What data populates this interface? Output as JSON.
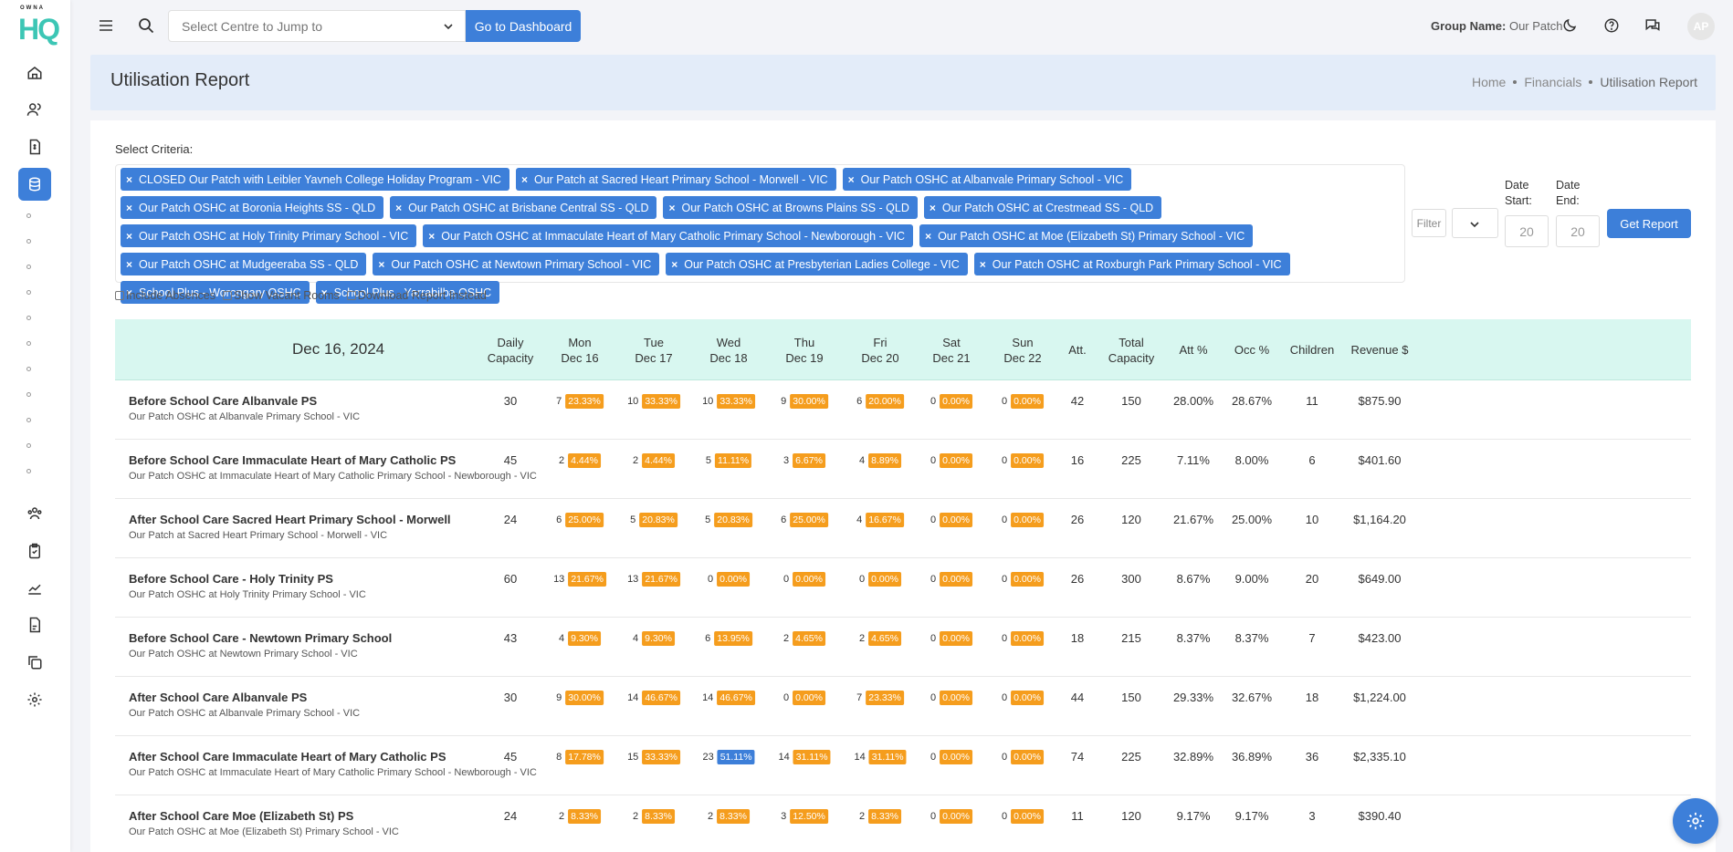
{
  "logo": {
    "top": "OWNA",
    "main": "HQ"
  },
  "topbar": {
    "centre_placeholder": "Select Centre to Jump to",
    "dashboard_button": "Go to Dashboard",
    "group_label": "Group Name:",
    "group_value": "Our Patch",
    "avatar_initials": "AP"
  },
  "header": {
    "title": "Utilisation Report",
    "breadcrumb": [
      "Home",
      "Financials",
      "Utilisation Report"
    ]
  },
  "criteria": {
    "label": "Select Criteria:",
    "chips": [
      "CLOSED Our Patch with Leibler Yavneh College Holiday Program - VIC",
      "Our Patch at Sacred Heart Primary School - Morwell - VIC",
      "Our Patch OSHC at Albanvale Primary School - VIC",
      "Our Patch OSHC at Boronia Heights SS - QLD",
      "Our Patch OSHC at Brisbane Central SS - QLD",
      "Our Patch OSHC at Browns Plains SS - QLD",
      "Our Patch OSHC at Crestmead SS - QLD",
      "Our Patch OSHC at Holy Trinity Primary School - VIC",
      "Our Patch OSHC at Immaculate Heart of Mary Catholic Primary School - Newborough - VIC",
      "Our Patch OSHC at Moe (Elizabeth St) Primary School - VIC",
      "Our Patch OSHC at Mudgeeraba SS - QLD",
      "Our Patch OSHC at Newtown Primary School - VIC",
      "Our Patch OSHC at Presbyterian Ladies College - VIC",
      "Our Patch OSHC at Roxburgh Park Primary School - VIC",
      "School Plus - Worongary OSHC",
      "School Plus - Yarrabilba OSHC"
    ],
    "filter_label": "Filter",
    "date_start_label": "Date Start:",
    "date_end_label": "Date End:",
    "date_start_value": "20",
    "date_end_value": "20",
    "get_report": "Get Report",
    "include_absences": "Include Absences",
    "show_vacant": "Show Vacant Rooms",
    "download_instead": "Download Report Instead"
  },
  "table": {
    "date_title": "Dec 16, 2024",
    "columns": {
      "daily_capacity": "Daily Capacity",
      "days": [
        [
          "Mon",
          "Dec 16"
        ],
        [
          "Tue",
          "Dec 17"
        ],
        [
          "Wed",
          "Dec 18"
        ],
        [
          "Thu",
          "Dec 19"
        ],
        [
          "Fri",
          "Dec 20"
        ],
        [
          "Sat",
          "Dec 21"
        ],
        [
          "Sun",
          "Dec 22"
        ]
      ],
      "att": "Att.",
      "total_capacity": "Total Capacity",
      "att_pct": "Att %",
      "occ_pct": "Occ %",
      "children": "Children",
      "revenue": "Revenue $"
    },
    "rows": [
      {
        "name": "Before School Care Albanvale PS",
        "centre": "Our Patch OSHC at Albanvale Primary School - VIC",
        "cap": "30",
        "days": [
          [
            "7",
            "23.33%"
          ],
          [
            "10",
            "33.33%"
          ],
          [
            "10",
            "33.33%"
          ],
          [
            "9",
            "30.00%"
          ],
          [
            "6",
            "20.00%"
          ],
          [
            "0",
            "0.00%"
          ],
          [
            "0",
            "0.00%"
          ]
        ],
        "att": "42",
        "total": "150",
        "attp": "28.00%",
        "occp": "28.67%",
        "children": "11",
        "revenue": "$875.90"
      },
      {
        "name": "Before School Care Immaculate Heart of Mary Catholic PS",
        "centre": "Our Patch OSHC at Immaculate Heart of Mary Catholic Primary School - Newborough - VIC",
        "cap": "45",
        "days": [
          [
            "2",
            "4.44%"
          ],
          [
            "2",
            "4.44%"
          ],
          [
            "5",
            "11.11%"
          ],
          [
            "3",
            "6.67%"
          ],
          [
            "4",
            "8.89%"
          ],
          [
            "0",
            "0.00%"
          ],
          [
            "0",
            "0.00%"
          ]
        ],
        "att": "16",
        "total": "225",
        "attp": "7.11%",
        "occp": "8.00%",
        "children": "6",
        "revenue": "$401.60"
      },
      {
        "name": "After School Care Sacred Heart Primary School - Morwell",
        "centre": "Our Patch at Sacred Heart Primary School - Morwell - VIC",
        "cap": "24",
        "days": [
          [
            "6",
            "25.00%"
          ],
          [
            "5",
            "20.83%"
          ],
          [
            "5",
            "20.83%"
          ],
          [
            "6",
            "25.00%"
          ],
          [
            "4",
            "16.67%"
          ],
          [
            "0",
            "0.00%"
          ],
          [
            "0",
            "0.00%"
          ]
        ],
        "att": "26",
        "total": "120",
        "attp": "21.67%",
        "occp": "25.00%",
        "children": "10",
        "revenue": "$1,164.20"
      },
      {
        "name": "Before School Care - Holy Trinity PS",
        "centre": "Our Patch OSHC at Holy Trinity Primary School - VIC",
        "cap": "60",
        "days": [
          [
            "13",
            "21.67%"
          ],
          [
            "13",
            "21.67%"
          ],
          [
            "0",
            "0.00%"
          ],
          [
            "0",
            "0.00%"
          ],
          [
            "0",
            "0.00%"
          ],
          [
            "0",
            "0.00%"
          ],
          [
            "0",
            "0.00%"
          ]
        ],
        "att": "26",
        "total": "300",
        "attp": "8.67%",
        "occp": "9.00%",
        "children": "20",
        "revenue": "$649.00"
      },
      {
        "name": "Before School Care - Newtown Primary School",
        "centre": "Our Patch OSHC at Newtown Primary School - VIC",
        "cap": "43",
        "days": [
          [
            "4",
            "9.30%"
          ],
          [
            "4",
            "9.30%"
          ],
          [
            "6",
            "13.95%"
          ],
          [
            "2",
            "4.65%"
          ],
          [
            "2",
            "4.65%"
          ],
          [
            "0",
            "0.00%"
          ],
          [
            "0",
            "0.00%"
          ]
        ],
        "att": "18",
        "total": "215",
        "attp": "8.37%",
        "occp": "8.37%",
        "children": "7",
        "revenue": "$423.00"
      },
      {
        "name": "After School Care Albanvale PS",
        "centre": "Our Patch OSHC at Albanvale Primary School - VIC",
        "cap": "30",
        "days": [
          [
            "9",
            "30.00%"
          ],
          [
            "14",
            "46.67%"
          ],
          [
            "14",
            "46.67%"
          ],
          [
            "0",
            "0.00%"
          ],
          [
            "7",
            "23.33%"
          ],
          [
            "0",
            "0.00%"
          ],
          [
            "0",
            "0.00%"
          ]
        ],
        "att": "44",
        "total": "150",
        "attp": "29.33%",
        "occp": "32.67%",
        "children": "18",
        "revenue": "$1,224.00"
      },
      {
        "name": "After School Care Immaculate Heart of Mary Catholic PS",
        "centre": "Our Patch OSHC at Immaculate Heart of Mary Catholic Primary School - Newborough - VIC",
        "cap": "45",
        "days": [
          [
            "8",
            "17.78%"
          ],
          [
            "15",
            "33.33%"
          ],
          [
            "23",
            "51.11%"
          ],
          [
            "14",
            "31.11%"
          ],
          [
            "14",
            "31.11%"
          ],
          [
            "0",
            "0.00%"
          ],
          [
            "0",
            "0.00%"
          ]
        ],
        "att": "74",
        "total": "225",
        "attp": "32.89%",
        "occp": "36.89%",
        "children": "36",
        "revenue": "$2,335.10"
      },
      {
        "name": "After School Care Moe (Elizabeth St) PS",
        "centre": "Our Patch OSHC at Moe (Elizabeth St) Primary School - VIC",
        "cap": "24",
        "days": [
          [
            "2",
            "8.33%"
          ],
          [
            "2",
            "8.33%"
          ],
          [
            "2",
            "8.33%"
          ],
          [
            "3",
            "12.50%"
          ],
          [
            "2",
            "8.33%"
          ],
          [
            "0",
            "0.00%"
          ],
          [
            "0",
            "0.00%"
          ]
        ],
        "att": "11",
        "total": "120",
        "attp": "9.17%",
        "occp": "9.17%",
        "children": "3",
        "revenue": "$390.40"
      }
    ]
  },
  "colors": {
    "accent": "#3d7fd9",
    "badge": "#f59d1d",
    "badge_high": "#3d7fd9",
    "header_bg": "#d8f7f0",
    "page_header_bg": "#e3ecf9"
  }
}
